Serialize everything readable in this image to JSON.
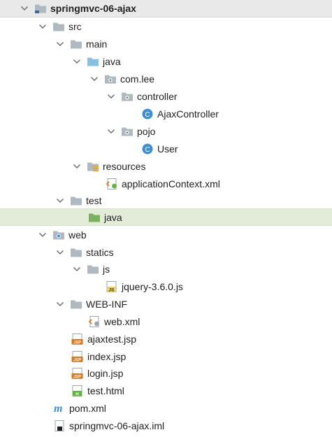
{
  "tree": {
    "root": "springmvc-06-ajax",
    "src": "src",
    "main": "main",
    "java_main": "java",
    "package": "com.lee",
    "controller": "controller",
    "ajax_controller": "AjaxController",
    "pojo": "pojo",
    "user": "User",
    "resources": "resources",
    "application_context": "applicationContext.xml",
    "test": "test",
    "java_test": "java",
    "web": "web",
    "statics": "statics",
    "js": "js",
    "jquery": "jquery-3.6.0.js",
    "web_inf": "WEB-INF",
    "web_xml": "web.xml",
    "ajaxtest_jsp": "ajaxtest.jsp",
    "index_jsp": "index.jsp",
    "login_jsp": "login.jsp",
    "test_html": "test.html",
    "pom_xml": "pom.xml",
    "iml": "springmvc-06-ajax.iml"
  },
  "icons": {
    "folder": "folder-icon",
    "java_source_folder": "java-source-folder-icon",
    "package_folder": "package-folder-icon",
    "resources_folder": "resources-folder-icon",
    "test_source_folder": "test-source-folder-icon",
    "web_folder": "web-folder-icon",
    "class": "java-class-icon",
    "xml": "xml-file-icon",
    "js": "js-file-icon",
    "jsp": "jsp-file-icon",
    "html": "html-file-icon",
    "maven": "maven-pom-icon",
    "iml": "iml-module-icon"
  },
  "colors": {
    "root_bg": "#e9e9e9",
    "selected_bg": "#e3ecd8",
    "folder": "#aeb9c0",
    "java_folder": "#87c0e0",
    "test_folder": "#7cb063",
    "class_icon": "#3d8fd1",
    "jsp_icon": "#d6761f",
    "html_icon": "#62b543"
  }
}
